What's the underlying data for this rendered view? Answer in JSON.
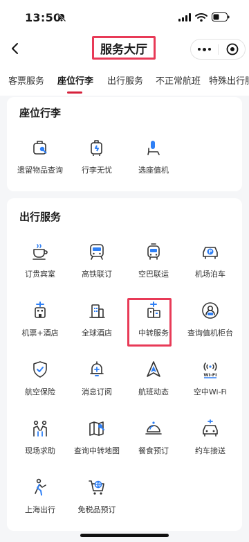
{
  "status_bar": {
    "time": "13:50"
  },
  "nav": {
    "title": "服务大厅"
  },
  "tabs": [
    {
      "label": "客票服务"
    },
    {
      "label": "座位行李"
    },
    {
      "label": "出行服务"
    },
    {
      "label": "不正常航班"
    },
    {
      "label": "特殊出行服务"
    }
  ],
  "sections": [
    {
      "title": "座位行李",
      "items": [
        {
          "label": "遗留物品查询",
          "icon": "lost-bag-search-icon"
        },
        {
          "label": "行李无忧",
          "icon": "luggage-care-icon"
        },
        {
          "label": "选座值机",
          "icon": "seat-checkin-icon"
        }
      ]
    },
    {
      "title": "出行服务",
      "items": [
        {
          "label": "订贵宾室",
          "icon": "lounge-cup-icon"
        },
        {
          "label": "高铁联订",
          "icon": "train-icon"
        },
        {
          "label": "空巴联运",
          "icon": "bus-icon"
        },
        {
          "label": "机场泊车",
          "icon": "parking-icon"
        },
        {
          "label": "机票+酒店",
          "icon": "flight-hotel-icon"
        },
        {
          "label": "全球酒店",
          "icon": "hotel-icon"
        },
        {
          "label": "中转服务",
          "icon": "transfer-icon"
        },
        {
          "label": "查询值机柜台",
          "icon": "checkin-counter-icon"
        },
        {
          "label": "航空保险",
          "icon": "shield-icon"
        },
        {
          "label": "消息订阅",
          "icon": "bell-icon"
        },
        {
          "label": "航班动态",
          "icon": "flight-status-icon"
        },
        {
          "label": "空中Wi-Fi",
          "icon": "wifi-icon"
        },
        {
          "label": "现场求助",
          "icon": "help-people-icon"
        },
        {
          "label": "查询中转地图",
          "icon": "map-search-icon"
        },
        {
          "label": "餐食预订",
          "icon": "meal-cloche-icon"
        },
        {
          "label": "约车接送",
          "icon": "car-icon"
        },
        {
          "label": "上海出行",
          "icon": "shanghai-travel-icon"
        },
        {
          "label": "免税品预订",
          "icon": "duty-free-cart-icon"
        }
      ]
    }
  ],
  "colors": {
    "accent": "#2e7ff5",
    "brand_red": "#d6213b",
    "highlight": "#e83a57"
  }
}
